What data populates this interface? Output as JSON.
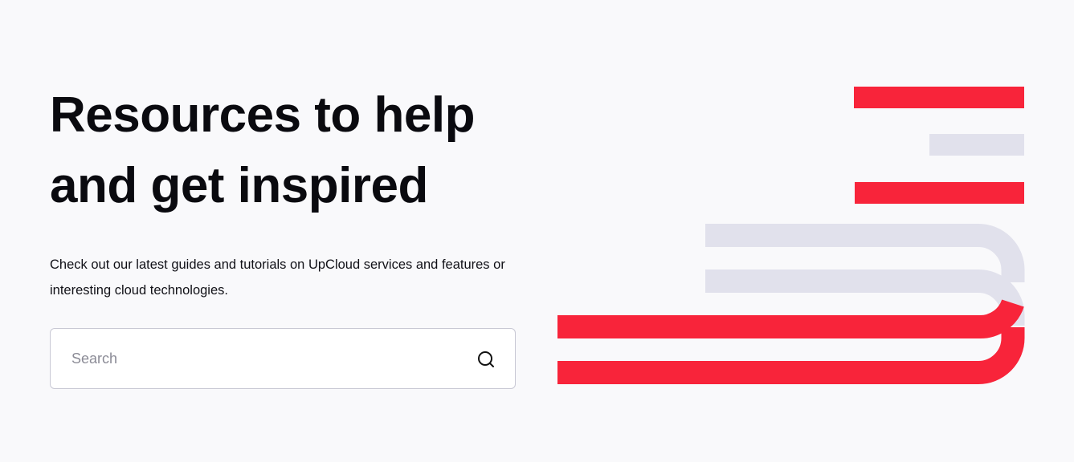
{
  "hero": {
    "title_line1": "Resources to help",
    "title_line2": "and get inspired",
    "description": "Check out our latest guides and tutorials on UpCloud services and features or interesting cloud technologies."
  },
  "search": {
    "placeholder": "Search",
    "value": ""
  },
  "colors": {
    "background": "#f9f9fb",
    "accent_red": "#f8243a",
    "stripe_gray": "#e1e1ec",
    "text": "#0a0a0f"
  },
  "icons": {
    "search": "search-icon",
    "graphic": "striped-brand-graphic"
  }
}
